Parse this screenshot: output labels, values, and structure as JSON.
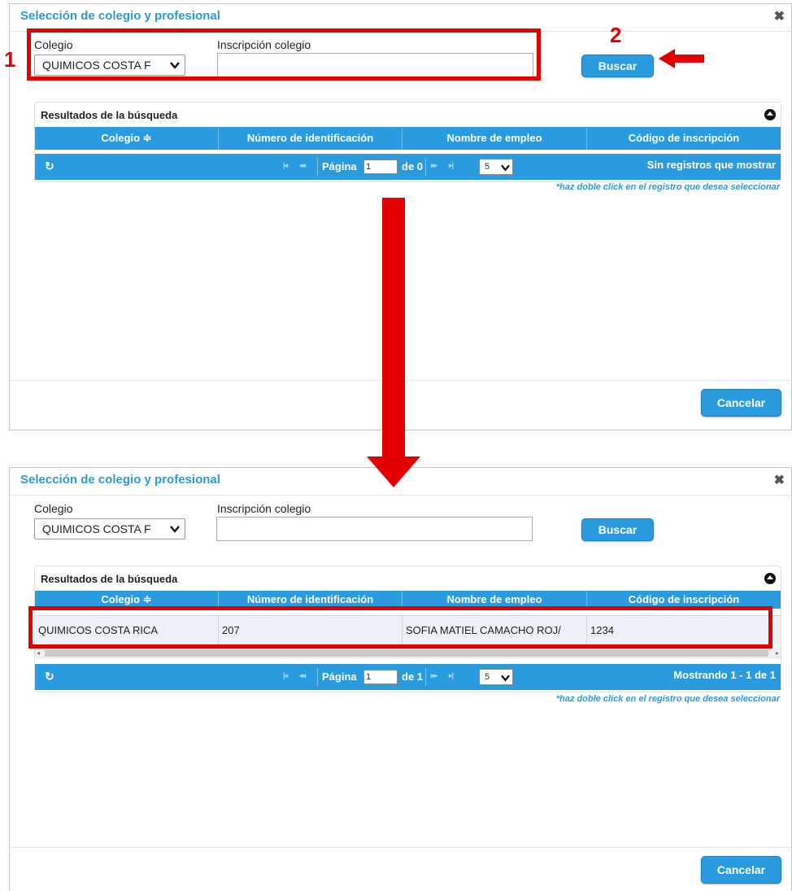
{
  "before": {
    "title": "Selección de colegio y profesional",
    "close_icon": "close-icon",
    "colegio_label": "Colegio",
    "colegio_value": "QUIMICOS COSTA F",
    "inscripcion_label": "Inscripción colegio",
    "inscripcion_value": "",
    "buscar_label": "Buscar",
    "results_title": "Resultados de la búsqueda",
    "columns": [
      "Colegio ≑",
      "Número de identificación",
      "Nombre de empleo",
      "Código de inscripción"
    ],
    "pager": {
      "page_label": "Página",
      "page_value": "1",
      "of_label": "de 0",
      "page_size": "5",
      "status": "Sin registros que mostrar"
    },
    "hint": "*haz doble click en el registro que desea seleccionar",
    "cancel_label": "Cancelar"
  },
  "after": {
    "title": "Selección de colegio y profesional",
    "close_icon": "close-icon",
    "colegio_label": "Colegio",
    "colegio_value": "QUIMICOS COSTA F",
    "inscripcion_label": "Inscripción colegio",
    "inscripcion_value": "",
    "buscar_label": "Buscar",
    "results_title": "Resultados de la búsqueda",
    "columns": [
      "Colegio ≑",
      "Número de identificación",
      "Nombre de empleo",
      "Código de inscripción"
    ],
    "row": [
      "QUIMICOS COSTA RICA",
      "207",
      "SOFIA MATIEL CAMACHO ROJ/",
      "1234"
    ],
    "pager": {
      "page_label": "Página",
      "page_value": "1",
      "of_label": "de 1",
      "page_size": "5",
      "status": "Mostrando 1 - 1 de 1"
    },
    "hint": "*haz doble click en el registro que desea seleccionar",
    "cancel_label": "Cancelar"
  },
  "annotations": {
    "step1": "1",
    "step2": "2",
    "color": "#e30000"
  },
  "theme": {
    "accent": "#2b9be0",
    "title_color": "#2a9ad8"
  }
}
